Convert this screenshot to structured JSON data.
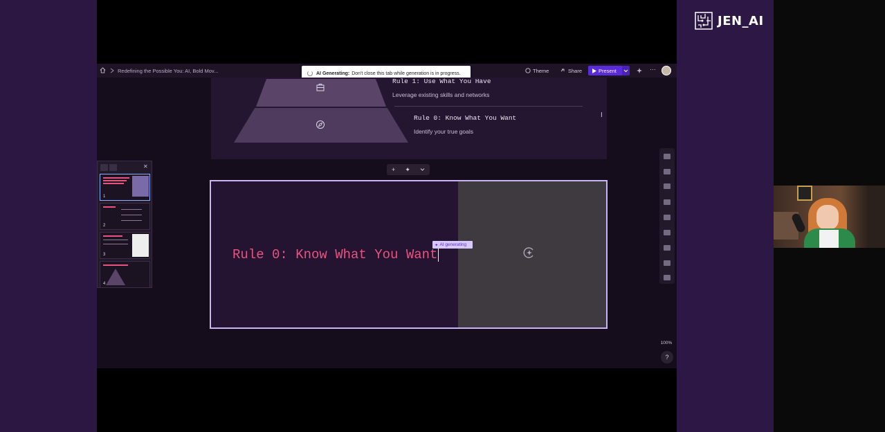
{
  "topbar": {
    "doc_title": "Redefining the Possible You: AI, Bold Mov...",
    "theme_label": "Theme",
    "share_label": "Share",
    "present_label": "Present"
  },
  "toast": {
    "bold": "AI Generating:",
    "message": "Don't close this tab while generation is in progress."
  },
  "prev_slide": {
    "rule1_title": "Rule 1: Use What You Have",
    "rule1_sub": "Leverage existing skills and networks",
    "rule0_title": "Rule 0: Know What You Want",
    "rule0_sub": "Identify your true goals"
  },
  "thumbnails": {
    "slides": [
      {
        "num": "1"
      },
      {
        "num": "2"
      },
      {
        "num": "3"
      },
      {
        "num": "4"
      }
    ]
  },
  "main_slide": {
    "title": "Rule 0: Know What You Want",
    "ai_chip": "AI generating"
  },
  "zoom": "100%",
  "help": "?",
  "logo": {
    "text": "JEN_AI"
  },
  "colors": {
    "accent_purple": "#5a2bd8",
    "slide_title_pink": "#e8547e",
    "selection_border": "#c9b4f5"
  }
}
